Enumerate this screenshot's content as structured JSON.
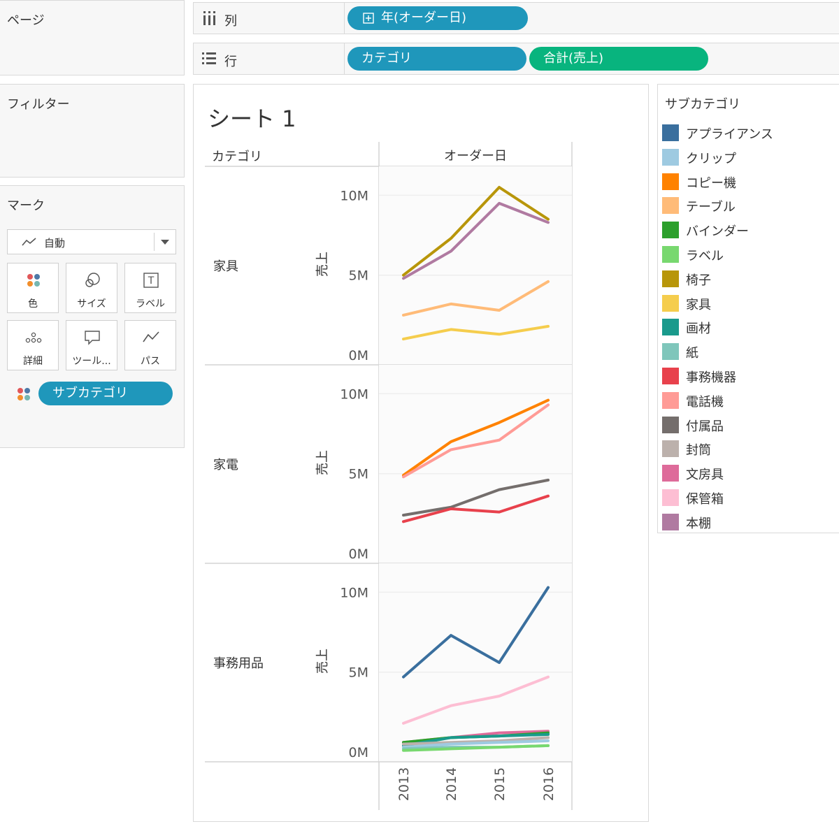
{
  "pages_panel": {
    "title": "ページ"
  },
  "filters_panel": {
    "title": "フィルター"
  },
  "marks_panel": {
    "title": "マーク",
    "mark_type": "自動",
    "buttons": [
      {
        "label": "色",
        "icon": "color-icon"
      },
      {
        "label": "サイズ",
        "icon": "size-icon"
      },
      {
        "label": "ラベル",
        "icon": "label-icon"
      },
      {
        "label": "詳細",
        "icon": "detail-icon"
      },
      {
        "label": "ツール...",
        "icon": "tooltip-icon"
      },
      {
        "label": "パス",
        "icon": "path-icon"
      }
    ],
    "color_pill": "サブカテゴリ"
  },
  "columns_shelf": {
    "label": "列",
    "pills": [
      "年(オーダー日)"
    ]
  },
  "rows_shelf": {
    "label": "行",
    "pills": [
      "カテゴリ",
      "合計(売上)"
    ]
  },
  "colors": {
    "pill_blue": "#1f97bb",
    "pill_green": "#08b47e"
  },
  "sheet": {
    "title": "シート 1",
    "row_header": "カテゴリ",
    "column_header": "オーダー日"
  },
  "legend": {
    "title": "サブカテゴリ",
    "items": [
      {
        "label": "アプライアンス",
        "color": "#3a6f9e"
      },
      {
        "label": "クリップ",
        "color": "#9ecae1"
      },
      {
        "label": "コピー機",
        "color": "#ff8200"
      },
      {
        "label": "テーブル",
        "color": "#ffbb78"
      },
      {
        "label": "バインダー",
        "color": "#2ca02c"
      },
      {
        "label": "ラベル",
        "color": "#78d86f"
      },
      {
        "label": "椅子",
        "color": "#b8960a"
      },
      {
        "label": "家具",
        "color": "#f5cd4d"
      },
      {
        "label": "画材",
        "color": "#1a9a8c"
      },
      {
        "label": "紙",
        "color": "#7fc6bb"
      },
      {
        "label": "事務機器",
        "color": "#e8414c"
      },
      {
        "label": "電話機",
        "color": "#ff9b96"
      },
      {
        "label": "付属品",
        "color": "#746e6c"
      },
      {
        "label": "封筒",
        "color": "#bcb1ac"
      },
      {
        "label": "文房具",
        "color": "#de6b9a"
      },
      {
        "label": "保管箱",
        "color": "#fdbed3"
      },
      {
        "label": "本棚",
        "color": "#b07aa1"
      }
    ]
  },
  "chart_data": {
    "type": "line",
    "x": [
      "2013",
      "2014",
      "2015",
      "2016"
    ],
    "ylabel": "売上",
    "yticks": [
      "0M",
      "5M",
      "10M"
    ],
    "ylim": [
      0,
      10.5
    ],
    "y_unit": "M",
    "panels": [
      {
        "category": "家具",
        "series": [
          {
            "name": "椅子",
            "values": [
              5.0,
              7.3,
              10.5,
              8.5
            ]
          },
          {
            "name": "本棚",
            "values": [
              4.8,
              6.5,
              9.5,
              8.3
            ]
          },
          {
            "name": "テーブル",
            "values": [
              2.5,
              3.2,
              2.8,
              4.6
            ]
          },
          {
            "name": "家具",
            "values": [
              1.0,
              1.6,
              1.3,
              1.8
            ]
          }
        ]
      },
      {
        "category": "家電",
        "series": [
          {
            "name": "コピー機",
            "values": [
              4.9,
              7.0,
              8.2,
              9.6
            ]
          },
          {
            "name": "電話機",
            "values": [
              4.8,
              6.5,
              7.1,
              9.3
            ]
          },
          {
            "name": "付属品",
            "values": [
              2.4,
              2.9,
              4.0,
              4.6
            ]
          },
          {
            "name": "事務機器",
            "values": [
              2.0,
              2.8,
              2.6,
              3.6
            ]
          }
        ]
      },
      {
        "category": "事務用品",
        "series": [
          {
            "name": "アプライアンス",
            "values": [
              4.7,
              7.3,
              5.6,
              10.3
            ]
          },
          {
            "name": "保管箱",
            "values": [
              1.8,
              2.9,
              3.5,
              4.7
            ]
          },
          {
            "name": "文房具",
            "values": [
              0.6,
              0.9,
              1.2,
              1.3
            ]
          },
          {
            "name": "バインダー",
            "values": [
              0.6,
              0.9,
              1.0,
              1.2
            ]
          },
          {
            "name": "画材",
            "values": [
              0.4,
              0.9,
              1.0,
              1.1
            ]
          },
          {
            "name": "封筒",
            "values": [
              0.5,
              0.6,
              0.7,
              0.9
            ]
          },
          {
            "name": "クリップ",
            "values": [
              0.3,
              0.5,
              0.6,
              0.7
            ]
          },
          {
            "name": "紙",
            "values": [
              0.2,
              0.3,
              0.3,
              0.4
            ]
          },
          {
            "name": "ラベル",
            "values": [
              0.1,
              0.2,
              0.3,
              0.4
            ]
          }
        ]
      }
    ]
  }
}
